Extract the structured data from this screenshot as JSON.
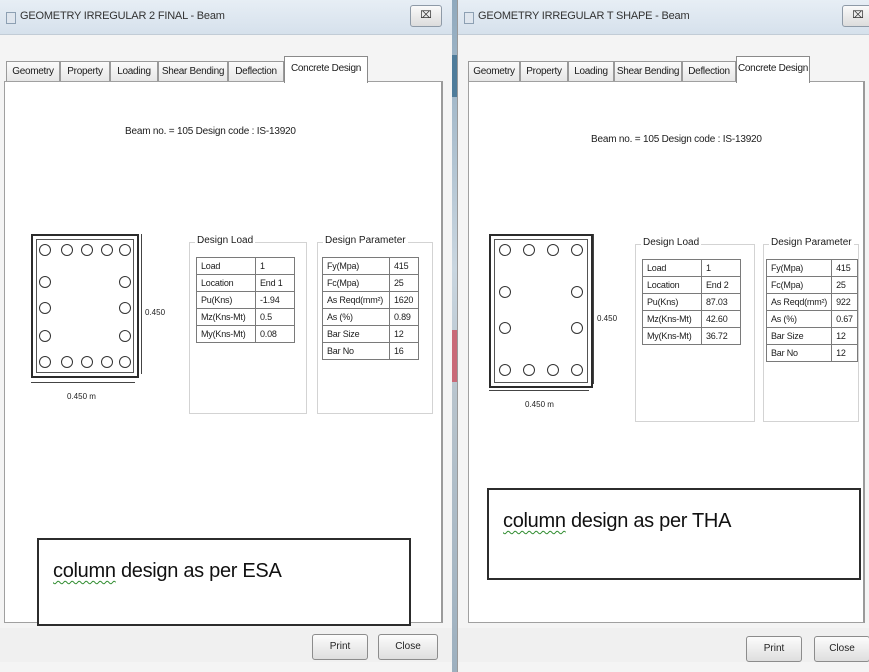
{
  "left": {
    "title": "GEOMETRY IRREGULAR 2 FINAL - Beam",
    "tabs": [
      "Geometry",
      "Property",
      "Loading",
      "Shear Bending",
      "Deflection",
      "Concrete Design"
    ],
    "active_tab": "Concrete Design",
    "beam_info": "Beam no. = 105  Design code : IS-13920",
    "dim_side": "0.450",
    "dim_bottom": "0.450 m",
    "design_load": {
      "legend": "Design Load",
      "rows": [
        [
          "Load",
          "1"
        ],
        [
          "Location",
          "End 1"
        ],
        [
          "Pu(Kns)",
          "-1.94"
        ],
        [
          "Mz(Kns-Mt)",
          "0.5"
        ],
        [
          "My(Kns-Mt)",
          "0.08"
        ]
      ]
    },
    "design_param": {
      "legend": "Design Parameter",
      "rows": [
        [
          "Fy(Mpa)",
          "415"
        ],
        [
          "Fc(Mpa)",
          "25"
        ],
        [
          "As Reqd(mm²)",
          "1620"
        ],
        [
          "As (%)",
          "0.89"
        ],
        [
          "Bar Size",
          "12"
        ],
        [
          "Bar No",
          "16"
        ]
      ]
    },
    "annotation": {
      "pre": "column",
      "post": " design as per ESA"
    },
    "buttons": {
      "print": "Print",
      "close": "Close"
    }
  },
  "right": {
    "title": "GEOMETRY IRREGULAR T SHAPE - Beam",
    "tabs": [
      "Geometry",
      "Property",
      "Loading",
      "Shear Bending",
      "Deflection",
      "Concrete Design"
    ],
    "active_tab": "Concrete Design",
    "beam_info": "Beam no. = 105  Design code : IS-13920",
    "dim_side": "0.450",
    "dim_bottom": "0.450 m",
    "design_load": {
      "legend": "Design Load",
      "rows": [
        [
          "Load",
          "1"
        ],
        [
          "Location",
          "End 2"
        ],
        [
          "Pu(Kns)",
          "87.03"
        ],
        [
          "Mz(Kns-Mt)",
          "42.60"
        ],
        [
          "My(Kns-Mt)",
          "36.72"
        ]
      ]
    },
    "design_param": {
      "legend": "Design Parameter",
      "rows": [
        [
          "Fy(Mpa)",
          "415"
        ],
        [
          "Fc(Mpa)",
          "25"
        ],
        [
          "As Reqd(mm²)",
          "922"
        ],
        [
          "As (%)",
          "0.67"
        ],
        [
          "Bar Size",
          "12"
        ],
        [
          "Bar No",
          "12"
        ]
      ]
    },
    "annotation": {
      "pre": "column",
      "post": " design as per THA"
    },
    "buttons": {
      "print": "Print",
      "close": "Close"
    }
  }
}
